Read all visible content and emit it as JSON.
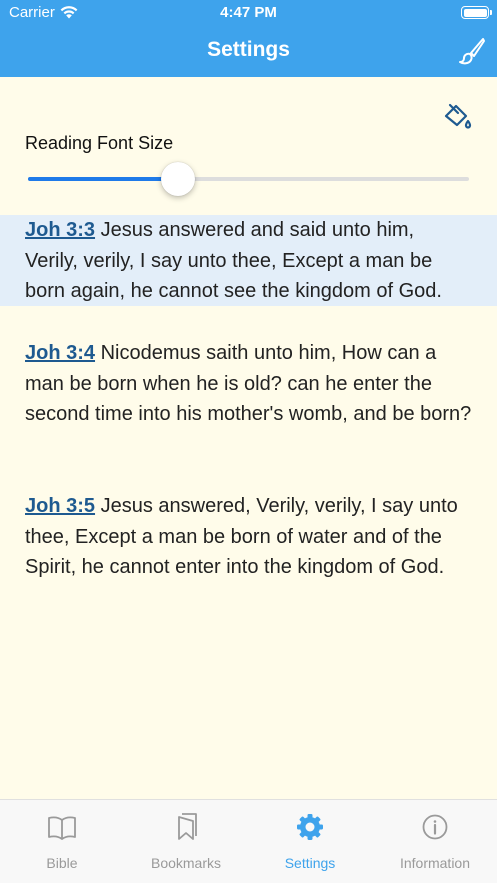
{
  "status_bar": {
    "carrier": "Carrier",
    "time": "4:47 PM"
  },
  "nav": {
    "title": "Settings",
    "right_icon": "brush-icon"
  },
  "settings": {
    "font_size_label": "Reading Font Size",
    "font_size_value": 0.34,
    "theme_icon": "paint-bucket-icon"
  },
  "verses": [
    {
      "ref": "Joh 3:3",
      "text": " Jesus answered and said unto him, Verily, verily, I say unto thee, Except a man be born again, he cannot see the kingdom of God.",
      "highlighted": true
    },
    {
      "ref": "Joh 3:4",
      "text": " Nicodemus saith unto him, How can a man be born when he is old? can he enter the second time into his mother's womb, and be born?",
      "highlighted": false
    },
    {
      "ref": "Joh 3:5",
      "text": " Jesus answered, Verily, verily, I say unto thee, Except a man be born of water and of the Spirit, he cannot enter into the kingdom of God.",
      "highlighted": false
    }
  ],
  "tabs": [
    {
      "label": "Bible",
      "icon": "book-icon",
      "active": false
    },
    {
      "label": "Bookmarks",
      "icon": "bookmark-icon",
      "active": false
    },
    {
      "label": "Settings",
      "icon": "gear-icon",
      "active": true
    },
    {
      "label": "Information",
      "icon": "info-icon",
      "active": false
    }
  ],
  "colors": {
    "accent": "#3ea3ec",
    "slider": "#1f7ae9",
    "background": "#fffcea",
    "highlight": "#e3eef9",
    "reference": "#1e5a90"
  }
}
